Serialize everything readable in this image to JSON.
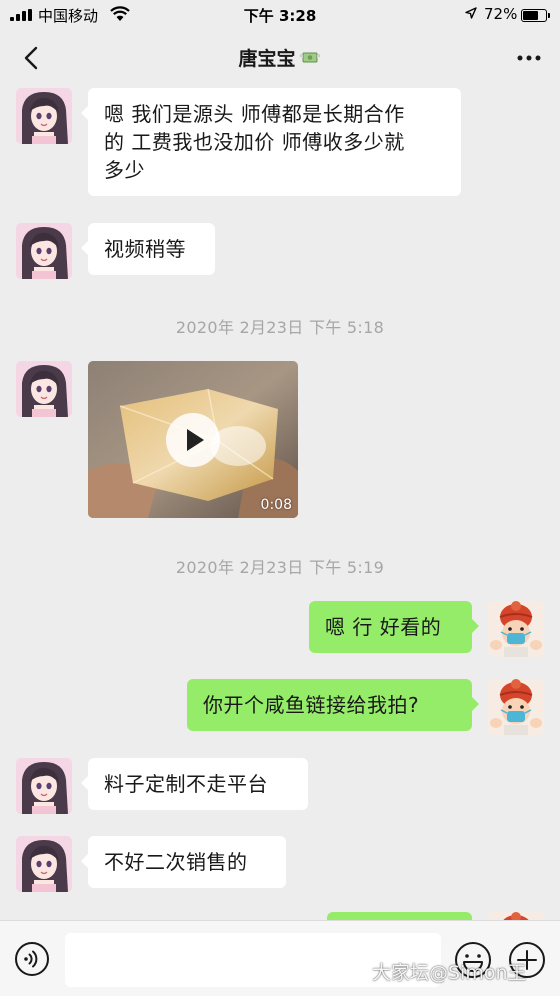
{
  "status_bar": {
    "carrier": "中国移动",
    "time": "下午 3:28",
    "battery_percent": "72%",
    "battery_level": 0.72
  },
  "nav": {
    "title": "唐宝宝",
    "title_emoji": "money-with-wings-icon"
  },
  "messages": [
    {
      "side": "left",
      "type": "text",
      "lines": [
        "嗯 我们是源头 师傅都是长期合作",
        "的 工费我也没加价 师傅收多少就",
        "多少"
      ]
    },
    {
      "side": "left",
      "type": "text",
      "text": "视频稍等"
    },
    {
      "type": "timestamp",
      "text": "2020年 2月23日 下午 5:18"
    },
    {
      "side": "left",
      "type": "video",
      "duration": "0:08"
    },
    {
      "type": "timestamp",
      "text": "2020年 2月23日 下午 5:19"
    },
    {
      "side": "right",
      "type": "text",
      "text": "嗯 行 好看的"
    },
    {
      "side": "right",
      "type": "text",
      "text": "你开个咸鱼链接给我拍?"
    },
    {
      "side": "left",
      "type": "text",
      "text": "料子定制不走平台"
    },
    {
      "side": "left",
      "type": "text",
      "text": "不好二次销售的"
    }
  ],
  "input_bar": {
    "placeholder": "",
    "icons": [
      "voice-icon",
      "emoji-icon",
      "plus-icon"
    ]
  },
  "watermark": "大家坛@Simon王",
  "colors": {
    "background": "#ededed",
    "bubble_left": "#ffffff",
    "bubble_right": "#95ec69",
    "timestamp": "#a6a6a6"
  }
}
